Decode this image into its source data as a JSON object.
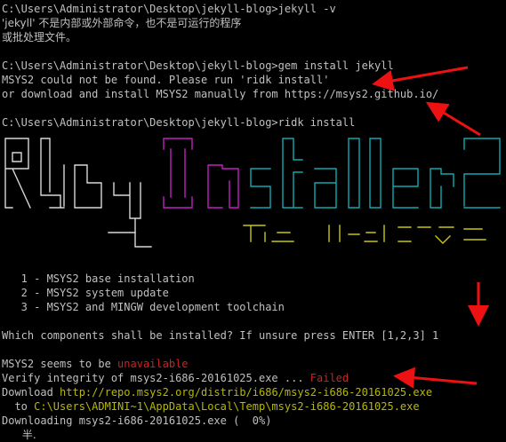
{
  "terminal": {
    "lines": [
      {
        "kind": "plain",
        "text": "C:\\Users\\Administrator\\Desktop\\jekyll-blog>jekyll -v"
      },
      {
        "kind": "cjk",
        "text": "'jekyll' 不是内部或外部命令，也不是可运行的程序"
      },
      {
        "kind": "cjk",
        "text": "或批处理文件。"
      },
      {
        "kind": "blank"
      },
      {
        "kind": "plain",
        "text": "C:\\Users\\Administrator\\Desktop\\jekyll-blog>gem install jekyll"
      },
      {
        "kind": "plain",
        "text": "MSYS2 could not be found. Please run 'ridk install'"
      },
      {
        "kind": "plain",
        "text": "or download and install MSYS2 manually from https://msys2.github.io/"
      },
      {
        "kind": "blank"
      },
      {
        "kind": "plain",
        "text": "C:\\Users\\Administrator\\Desktop\\jekyll-blog>ridk install"
      }
    ],
    "menu": [
      "   1 - MSYS2 base installation",
      "   2 - MSYS2 system update",
      "   3 - MSYS2 and MINGW development toolchain"
    ],
    "prompt_line": "Which components shall be installed? If unsure press ENTER [1,2,3] 1",
    "status": {
      "seems_prefix": "MSYS2 seems to be ",
      "seems_word": "unavailable",
      "verify_prefix": "Verify integrity of msys2-i686-20161025.exe ... ",
      "verify_word": "Failed",
      "download_prefix": "Download ",
      "download_url": "http://repo.msys2.org/distrib/i686/msys2-i686-20161025.exe",
      "to_prefix": "  to ",
      "to_path": "C:\\Users\\ADMINI~1\\AppData\\Local\\Temp\\msys2-i686-20161025.exe",
      "downloading": "Downloading msys2-i686-20161025.exe (  0%)",
      "last_partial": "      半."
    }
  },
  "colors": {
    "background": "#000000",
    "text": "#c0c0c0",
    "error": "#cc2222",
    "link": "#b8b800",
    "arrow": "#ee1111",
    "banner_white": "#d8d8d8",
    "banner_magenta": "#c020c0",
    "banner_teal": "#10a8b0",
    "banner_yellow": "#c8c810"
  }
}
